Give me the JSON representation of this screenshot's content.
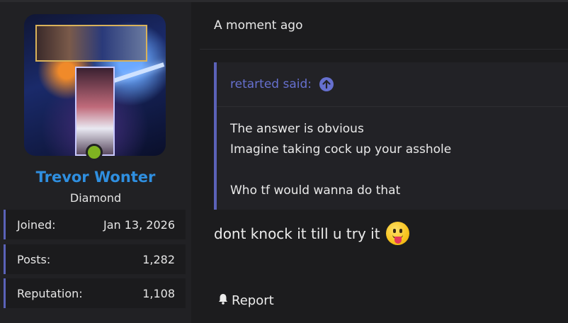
{
  "post": {
    "timestamp": "A moment ago",
    "author": {
      "name": "Trevor Wonter",
      "title": "Diamond",
      "online": true,
      "stats": [
        {
          "label": "Joined:",
          "value": "Jan 13, 2026"
        },
        {
          "label": "Posts:",
          "value": "1,282"
        },
        {
          "label": "Reputation:",
          "value": "1,108"
        }
      ]
    },
    "quote": {
      "header": "retarted said:",
      "lines": [
        "The answer is obvious",
        "Imagine taking cock up your asshole",
        "",
        "Who tf would wanna do that"
      ]
    },
    "message": {
      "text": "dont knock it till u try it",
      "emoji": "face-with-tongue"
    },
    "actions": {
      "report_label": "Report"
    }
  },
  "colors": {
    "username": "#2f8fe0",
    "quote_accent": "#5b62b8",
    "online": "#7fb321",
    "background": "#1c1c1e"
  }
}
